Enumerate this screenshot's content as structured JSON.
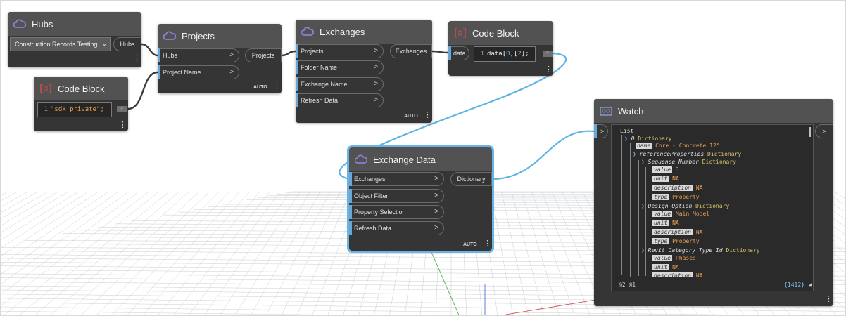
{
  "nodes": {
    "hubs": {
      "title": "Hubs",
      "dropdown_value": "Construction Records Testing",
      "output": "Hubs"
    },
    "projects": {
      "title": "Projects",
      "inputs": [
        "Hubs",
        "Project Name"
      ],
      "output": "Projects",
      "lacing": "AUTO"
    },
    "code_block_1": {
      "title": "Code Block",
      "line_number": "1",
      "code": "\"sdk private\";",
      "out_glyph": ">"
    },
    "exchanges": {
      "title": "Exchanges",
      "inputs": [
        "Projects",
        "Folder Name",
        "Exchange Name",
        "Refresh Data"
      ],
      "output": "Exchanges",
      "lacing": "AUTO"
    },
    "code_block_2": {
      "title": "Code Block",
      "input": "data",
      "line_number": "1",
      "code": "data[0][2];",
      "out_glyph": ">"
    },
    "exchange_data": {
      "title": "Exchange Data",
      "inputs": [
        "Exchanges",
        "Object Filter",
        "Property Selection",
        "Refresh Data"
      ],
      "output": "Dictionary",
      "lacing": "AUTO"
    },
    "watch": {
      "title": "Watch",
      "in_glyph": ">",
      "out_glyph": ">",
      "footer_levels": "@2 @1",
      "footer_count": "{1412}",
      "tree": {
        "list": "List",
        "item0_index": "0",
        "item0_type": "Dictionary",
        "name_key": "name",
        "name_val": "Core - Concrete 12\"",
        "refprops_key": "referenceProperties",
        "refprops_type": "Dictionary",
        "seq_key": "Sequence Number",
        "seq_type": "Dictionary",
        "seq_value": "3",
        "seq_unit": "NA",
        "seq_desc": "NA",
        "seq_typev": "Property",
        "design_key": "Design Option",
        "design_type": "Dictionary",
        "design_value": "Main Model",
        "design_unit": "NA",
        "design_desc": "NA",
        "design_typev": "Property",
        "revit_key": "Revit Category Type Id",
        "revit_type": "Dictionary",
        "revit_value": "Phases",
        "revit_unit": "NA",
        "revit_desc": "NA",
        "k_value": "value",
        "k_unit": "unit",
        "k_description": "description",
        "k_type": "type"
      }
    }
  },
  "icons": {
    "cloud": "cloud-icon",
    "code": "code-block-icon",
    "watch": "watch-icon"
  },
  "colors": {
    "wire": "#5fb4e2",
    "port_accent": "#6aa6d6",
    "node_bg": "#353535",
    "header_bg": "#525252"
  }
}
